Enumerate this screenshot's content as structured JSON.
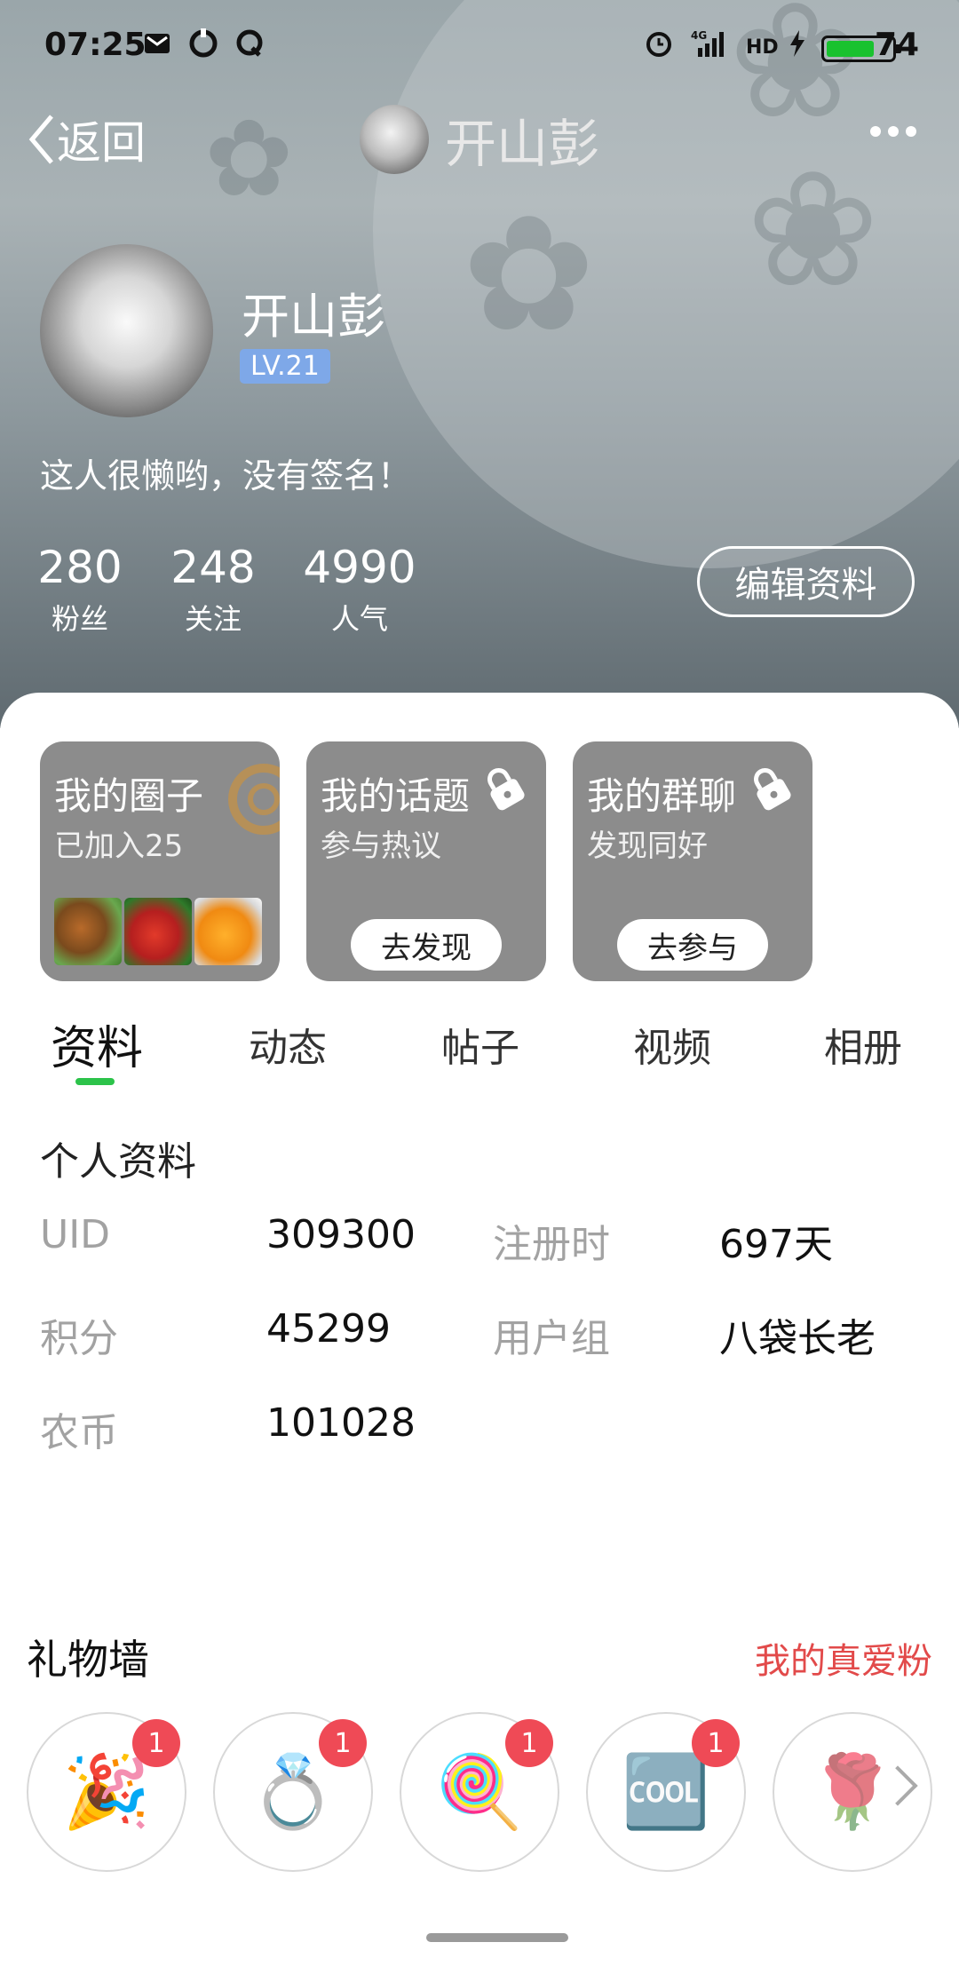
{
  "status_bar": {
    "time": "07:25",
    "battery": "74",
    "battery_level": 0.74
  },
  "nav": {
    "back_label": "返回",
    "title": "开山彭"
  },
  "profile": {
    "name": "开山彭",
    "level": "LV.21",
    "signature": "这人很懒哟，没有签名！",
    "stats": [
      {
        "value": "280",
        "label": "粉丝"
      },
      {
        "value": "248",
        "label": "关注"
      },
      {
        "value": "4990",
        "label": "人气"
      }
    ],
    "edit_label": "编辑资料"
  },
  "cards": [
    {
      "title": "我的圈子",
      "subtitle": "已加入25"
    },
    {
      "title": "我的话题",
      "subtitle": "参与热议",
      "button": "去发现"
    },
    {
      "title": "我的群聊",
      "subtitle": "发现同好",
      "button": "去参与"
    }
  ],
  "tabs": [
    "资料",
    "动态",
    "帖子",
    "视频",
    "相册"
  ],
  "info": {
    "title": "个人资料",
    "rows": [
      {
        "label": "UID",
        "value": "309300",
        "label2": "注册时",
        "value2": "697天"
      },
      {
        "label": "积分",
        "value": "45299",
        "label2": "用户组",
        "value2": "八袋长老"
      },
      {
        "label": "农币",
        "value": "101028"
      }
    ]
  },
  "gifts": {
    "title": "礼物墙",
    "link": "我的真爱粉",
    "items": [
      {
        "icon": "party-popper-icon",
        "count": "1"
      },
      {
        "icon": "diamond-ring-icon",
        "count": "1"
      },
      {
        "icon": "lollipop-icon",
        "count": "1"
      },
      {
        "icon": "cool-sticker-icon",
        "count": "1"
      },
      {
        "icon": "rose-icon"
      }
    ]
  },
  "colors": {
    "accent_green": "#2cc34a",
    "badge_red": "#ef4a56",
    "link_red": "#e24a4a",
    "level_blue": "#7ea8e8"
  }
}
